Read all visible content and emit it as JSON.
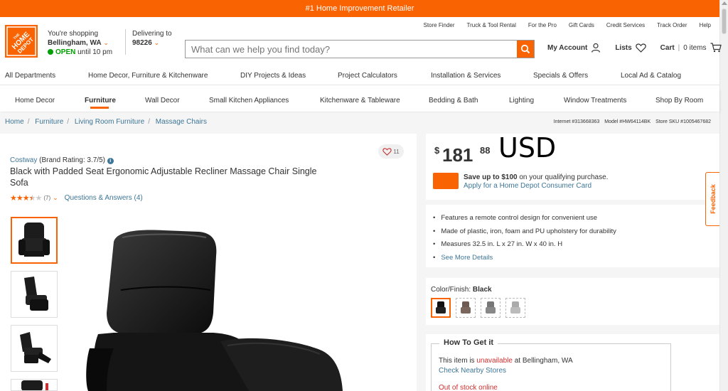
{
  "promo_bar": {
    "text": "#1 Home Improvement Retailer"
  },
  "util_links": [
    "Store Finder",
    "Truck & Tool Rental",
    "For the Pro",
    "Gift Cards",
    "Credit Services",
    "Track Order",
    "Help"
  ],
  "logo": {
    "text": "THE HOME DEPOT"
  },
  "store": {
    "label": "You're shopping",
    "location": "Bellingham, WA",
    "status": "OPEN",
    "hours": "until 10 pm"
  },
  "delivery": {
    "label": "Delivering to",
    "zip": "98226"
  },
  "search": {
    "placeholder": "What can we help you find today?"
  },
  "account": {
    "my_account": "My Account",
    "lists": "Lists",
    "cart": "Cart",
    "cart_count": "0 items"
  },
  "nav_primary": [
    "All Departments",
    "Home Decor, Furniture & Kitchenware",
    "DIY Projects & Ideas",
    "Project Calculators",
    "Installation & Services",
    "Specials & Offers",
    "Local Ad & Catalog"
  ],
  "nav_secondary": [
    "Home Decor",
    "Furniture",
    "Wall Decor",
    "Small Kitchen Appliances",
    "Kitchenware & Tableware",
    "Bedding & Bath",
    "Lighting",
    "Window Treatments",
    "Shop By Room"
  ],
  "breadcrumb": [
    "Home",
    "Furniture",
    "Living Room Furniture",
    "Massage Chairs"
  ],
  "ids": {
    "internet": "Internet #313668363",
    "model": "Model #HW64114BK",
    "sku": "Store SKU #1005467682"
  },
  "product": {
    "brand": "Costway",
    "brand_rating": "(Brand Rating: 3.7/5)",
    "title": "Black with Padded Seat Ergonomic Adjustable Recliner Massage Chair Single Sofa",
    "rating": 3.5,
    "review_count": "(7)",
    "qa": "Questions & Answers (4)",
    "favorites": "11"
  },
  "price": {
    "dollar": "$",
    "whole": "181",
    "cents": "88",
    "currency": "USD"
  },
  "credit_offer": {
    "line1_bold": "Save up to $100",
    "line1_rest": " on your qualifying purchase.",
    "link": "Apply for a Home Depot Consumer Card"
  },
  "features": [
    "Features a remote control design for convenient use",
    "Made of plastic, iron, foam and PU upholstery for durability",
    "Measures 32.5 in. L x 27 in. W x 40 in. H"
  ],
  "see_more": "See More Details",
  "color": {
    "label": "Color/Finish:",
    "value": "Black"
  },
  "how_to_get": {
    "title": "How To Get it",
    "text_prefix": "This item is ",
    "unavailable": "unavailable",
    "text_suffix": " at Bellingham, WA",
    "check_nearby": "Check Nearby Stores",
    "out_of_stock": "Out of stock online"
  },
  "feedback": "Feedback",
  "colors": {
    "accent": "#f96302",
    "link": "#3e7697",
    "success": "#00a000",
    "error": "#d32f2f"
  }
}
